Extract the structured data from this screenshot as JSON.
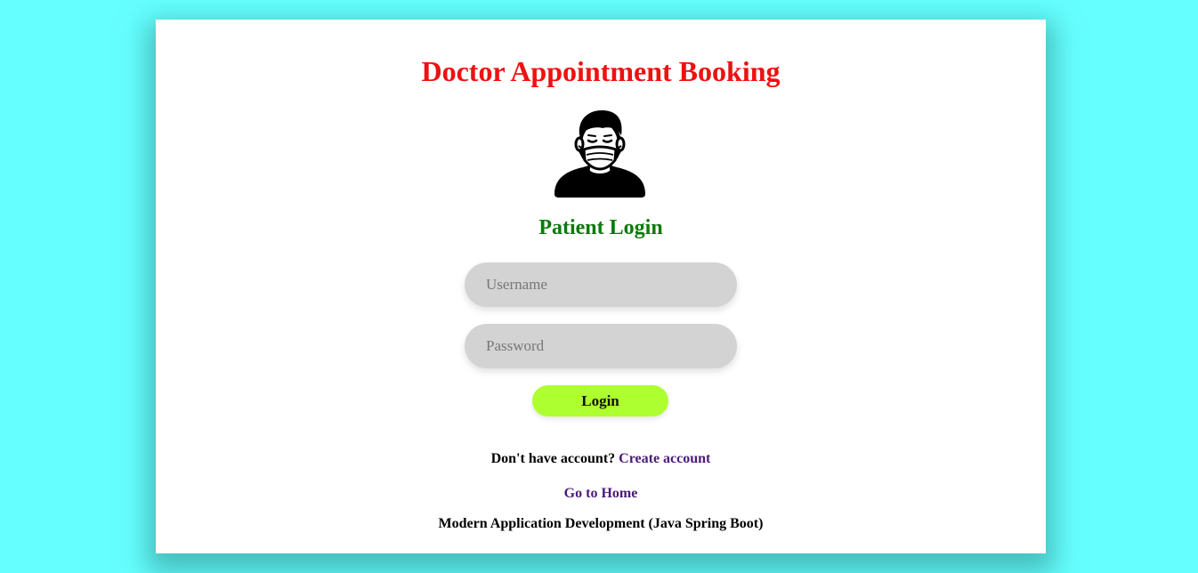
{
  "header": {
    "title": "Doctor Appointment Booking"
  },
  "avatar": {
    "icon": "masked-patient-icon"
  },
  "form": {
    "heading": "Patient Login",
    "username_placeholder": "Username",
    "username_value": "",
    "password_placeholder": "Password",
    "password_value": "",
    "login_label": "Login"
  },
  "signup": {
    "prompt": "Don't have account?",
    "link_label": "Create account"
  },
  "nav": {
    "home_label": "Go to Home"
  },
  "footer": {
    "text": "Modern Application Development (Java Spring Boot)"
  },
  "colors": {
    "page_background": "#66ffff",
    "title": "#ee1111",
    "heading": "#0a7a0a",
    "button": "#adff2f",
    "link": "#4b1a7a",
    "field": "#d3d3d3"
  }
}
